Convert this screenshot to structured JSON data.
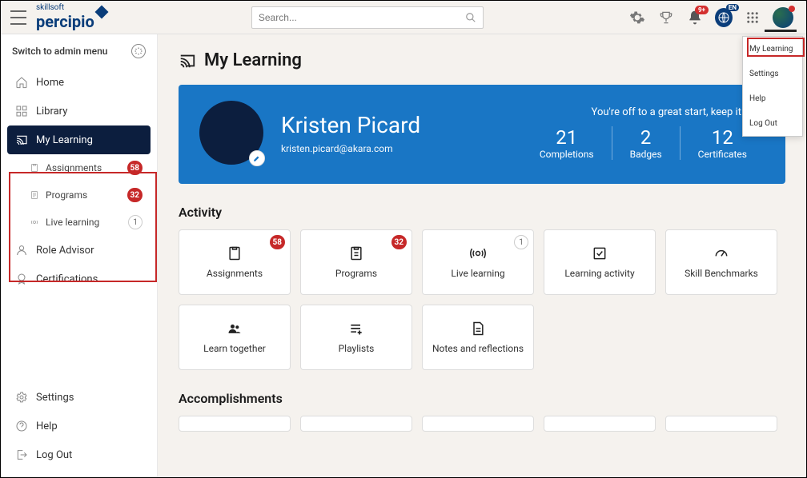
{
  "brand": {
    "top": "skillsoft",
    "main": "percipio"
  },
  "search": {
    "placeholder": "Search..."
  },
  "header": {
    "notifications_badge": "9+",
    "lang": "EN"
  },
  "admin_toggle": "Switch to admin menu",
  "nav": {
    "home": "Home",
    "library": "Library",
    "my_learning": "My Learning",
    "assignments": "Assignments",
    "programs": "Programs",
    "live_learning": "Live learning",
    "role_advisor": "Role Advisor",
    "certifications": "Certifications",
    "settings": "Settings",
    "help": "Help",
    "logout": "Log Out",
    "badges": {
      "assignments": "58",
      "programs": "32",
      "live": "1"
    }
  },
  "page_title": "My Learning",
  "hero": {
    "name": "Kristen Picard",
    "email": "kristen.picard@akara.com",
    "message": "You're off to a great start, keep it up!",
    "completions_num": "21",
    "completions_lbl": "Completions",
    "badges_num": "2",
    "badges_lbl": "Badges",
    "certs_num": "12",
    "certs_lbl": "Certificates"
  },
  "activity": {
    "title": "Activity",
    "cards": {
      "assignments": "Assignments",
      "programs": "Programs",
      "live": "Live learning",
      "activity": "Learning activity",
      "benchmarks": "Skill Benchmarks",
      "together": "Learn together",
      "playlists": "Playlists",
      "notes": "Notes and reflections"
    },
    "badges": {
      "assignments": "58",
      "programs": "32",
      "live": "1"
    }
  },
  "accomplishments_title": "Accomplishments",
  "dropdown": {
    "my_learning": "My Learning",
    "settings": "Settings",
    "help": "Help",
    "logout": "Log Out"
  }
}
